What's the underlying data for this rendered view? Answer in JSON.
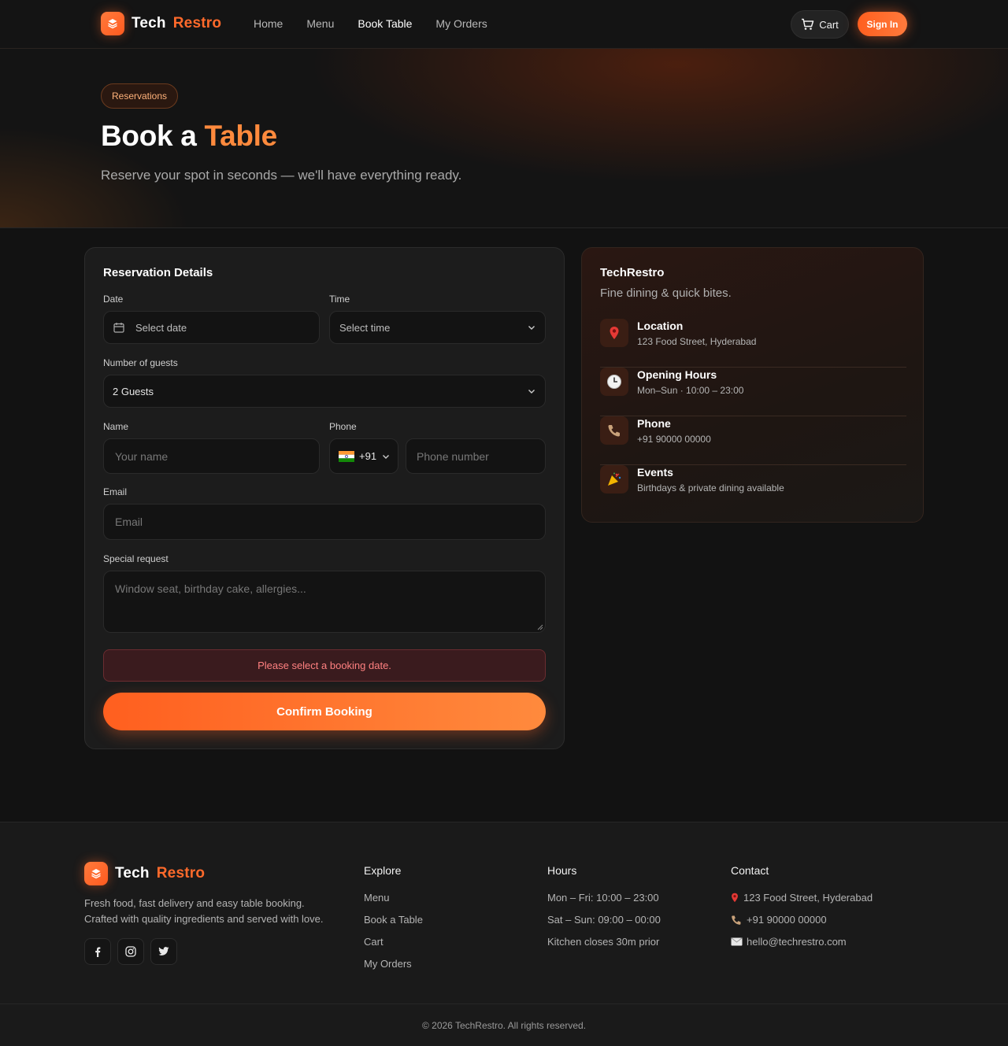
{
  "brand": {
    "word1": "Tech",
    "word2": "Restro"
  },
  "nav": {
    "links": [
      "Home",
      "Menu",
      "Book Table",
      "My Orders"
    ],
    "active": "Book Table",
    "cart_label": "Cart",
    "signin_label": "Sign In"
  },
  "hero": {
    "badge": "Reservations",
    "title_main": "Book a",
    "title_accent": "Table",
    "subtitle": "Reserve your spot in seconds — we'll have everything ready."
  },
  "form": {
    "title": "Reservation Details",
    "date_label": "Date",
    "date_placeholder": "Select date",
    "time_label": "Time",
    "time_placeholder": "Select time",
    "guests_label": "Number of guests",
    "guests_value": "2 Guests",
    "name_label": "Name",
    "name_placeholder": "Your name",
    "phone_label": "Phone",
    "phone_code": "+91",
    "phone_placeholder": "Phone number",
    "email_label": "Email",
    "email_placeholder": "Email",
    "request_label": "Special request",
    "request_placeholder": "Window seat, birthday cake, allergies...",
    "error": "Please select a booking date.",
    "confirm_label": "Confirm Booking"
  },
  "info": {
    "title": "TechRestro",
    "tagline": "Fine dining & quick bites.",
    "items": [
      {
        "icon": "location-pin-icon",
        "title": "Location",
        "detail": "123 Food Street, Hyderabad"
      },
      {
        "icon": "clock-icon",
        "title": "Opening Hours",
        "detail": "Mon–Sun · 10:00 – 23:00"
      },
      {
        "icon": "phone-icon",
        "title": "Phone",
        "detail": "+91 90000 00000"
      },
      {
        "icon": "party-popper-icon",
        "title": "Events",
        "detail": "Birthdays & private dining available"
      }
    ]
  },
  "footer": {
    "description_1": "Fresh food, fast delivery and easy table booking.",
    "description_2": "Crafted with quality ingredients and served with love.",
    "explore": {
      "heading": "Explore",
      "items": [
        "Menu",
        "Book a Table",
        "Cart",
        "My Orders"
      ]
    },
    "hours": {
      "heading": "Hours",
      "items": [
        "Mon – Fri: 10:00 – 23:00",
        "Sat – Sun: 09:00 – 00:00",
        "Kitchen closes 30m prior"
      ]
    },
    "contact": {
      "heading": "Contact",
      "items": [
        "123 Food Street, Hyderabad",
        "+91 90000 00000",
        "hello@techrestro.com"
      ]
    },
    "copyright": "© 2026 TechRestro. All rights reserved."
  },
  "colors": {
    "accent": "#ff6a2b",
    "background": "#121212",
    "card": "#1c1c1c",
    "error": "#ff8080"
  }
}
